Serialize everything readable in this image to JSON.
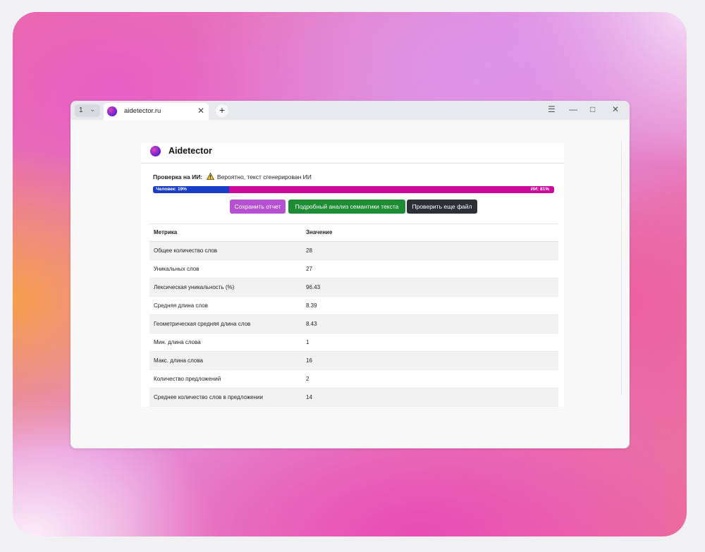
{
  "browser": {
    "tab_count": "1",
    "tab_title": "aidetector.ru",
    "new_tab": "+",
    "controls": {
      "menu": "☰",
      "minimize": "—",
      "maximize": "□",
      "close": "✕"
    }
  },
  "site": {
    "brand": "Aidetector"
  },
  "check": {
    "label": "Проверка на ИИ:",
    "result": "Вероятно, текст сгенерирован ИИ",
    "human_percent": 19,
    "ai_percent": 81,
    "human_label": "Человек: 19%",
    "ai_label": "ИИ: 81%",
    "colors": {
      "human": "#1a3ec8",
      "ai": "#cc0a99"
    }
  },
  "buttons": {
    "save": "Сохранить отчет",
    "analysis": "Подробный анализ семантики текста",
    "again": "Проверить еще файл"
  },
  "table": {
    "headers": [
      "Метрика",
      "Значение"
    ],
    "rows": [
      [
        "Общее количество слов",
        "28"
      ],
      [
        "Уникальных слов",
        "27"
      ],
      [
        "Лексическая уникальность (%)",
        "96.43"
      ],
      [
        "Средняя длина слов",
        "8.39"
      ],
      [
        "Геометрическая средняя длина слов",
        "8.43"
      ],
      [
        "Мин. длина слова",
        "1"
      ],
      [
        "Макс. длина слова",
        "16"
      ],
      [
        "Количество предложений",
        "2"
      ],
      [
        "Среднее количество слов в предложении",
        "14"
      ]
    ]
  }
}
